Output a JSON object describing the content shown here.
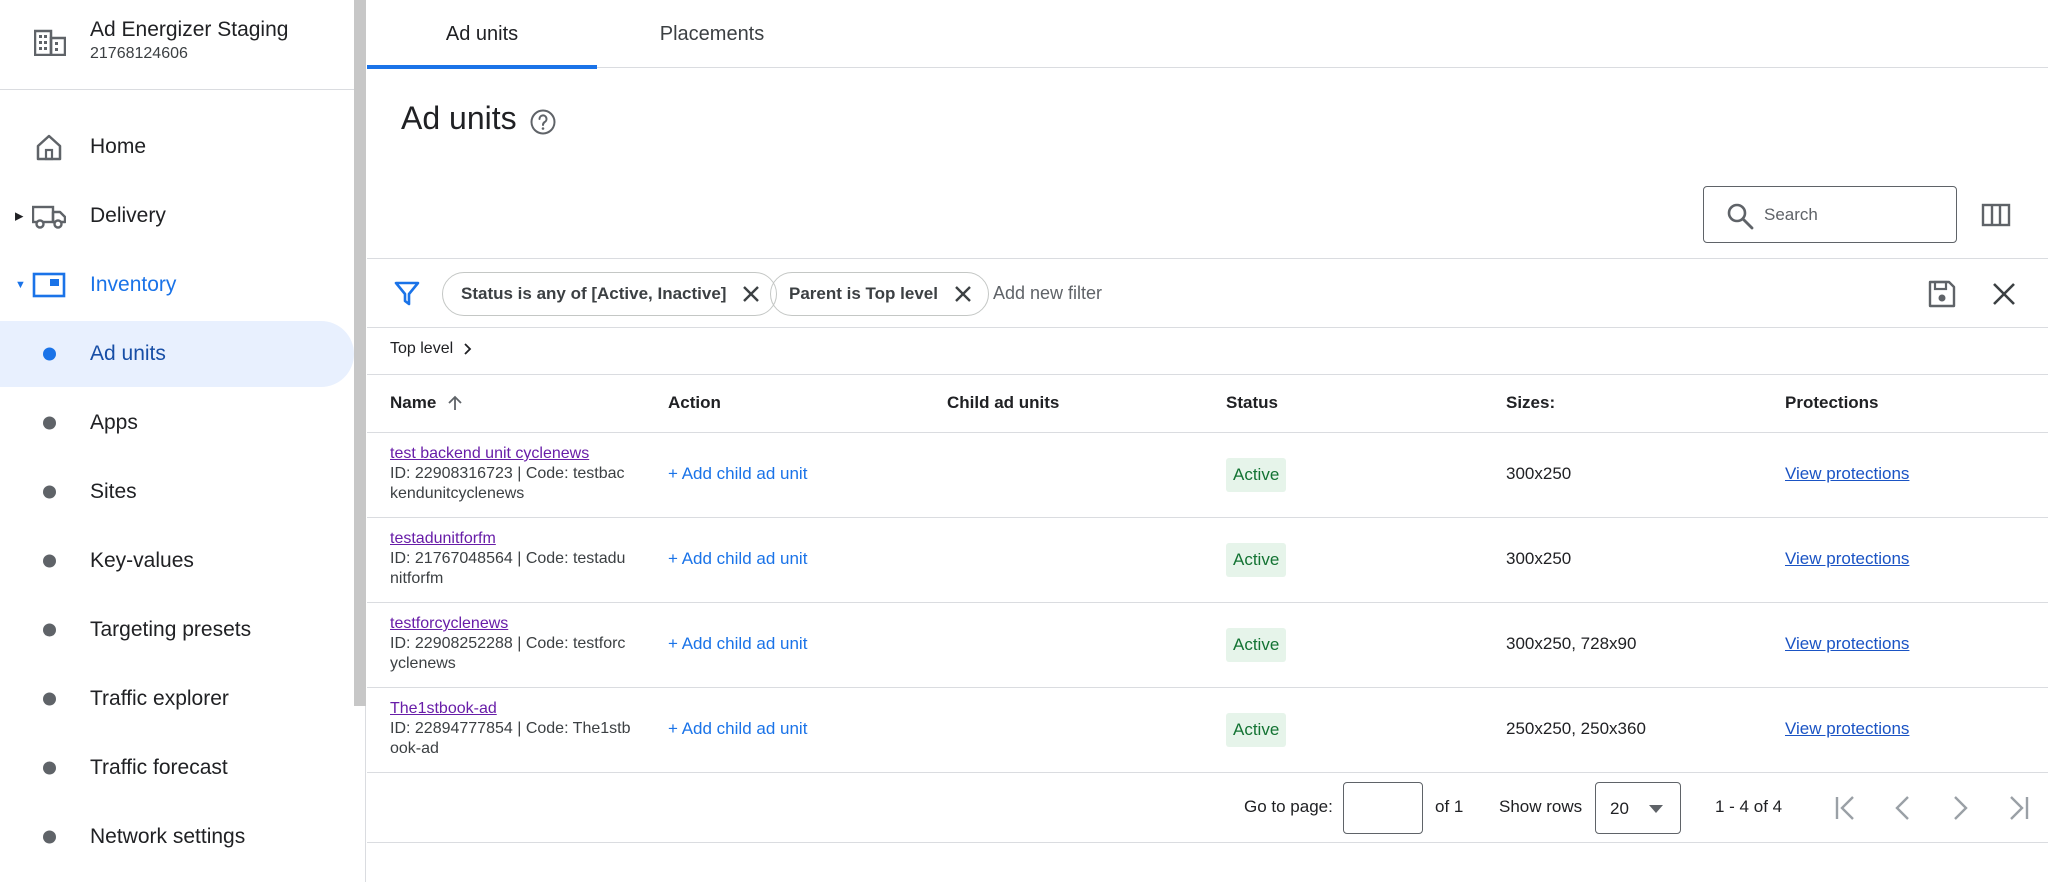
{
  "account": {
    "name": "Ad Energizer Staging",
    "id": "21768124606",
    "icon": "building-icon"
  },
  "sidebar": {
    "items": [
      {
        "label": "Home",
        "icon": "home-icon"
      },
      {
        "label": "Delivery",
        "icon": "truck-icon"
      },
      {
        "label": "Inventory",
        "icon": "inventory-icon"
      },
      {
        "label": "Ad units"
      },
      {
        "label": "Apps"
      },
      {
        "label": "Sites"
      },
      {
        "label": "Key-values"
      },
      {
        "label": "Targeting presets"
      },
      {
        "label": "Traffic explorer"
      },
      {
        "label": "Traffic forecast"
      },
      {
        "label": "Network settings"
      }
    ]
  },
  "tabs": [
    {
      "label": "Ad units"
    },
    {
      "label": "Placements"
    }
  ],
  "page": {
    "title": "Ad units"
  },
  "search": {
    "placeholder": "Search"
  },
  "filters": {
    "chips": [
      {
        "label": "Status is any of [Active, Inactive]"
      },
      {
        "label": "Parent is Top level"
      }
    ],
    "add_placeholder": "Add new filter"
  },
  "breadcrumb": {
    "label": "Top level"
  },
  "table": {
    "columns": [
      {
        "label": "Name"
      },
      {
        "label": "Action"
      },
      {
        "label": "Child ad units"
      },
      {
        "label": "Status"
      },
      {
        "label": "Sizes:"
      },
      {
        "label": "Protections"
      }
    ],
    "rows": [
      {
        "name": "test backend unit cyclenews",
        "meta": "ID: 22908316723 | Code: testbac kendunitcyclenews",
        "action": "+ Add child ad unit",
        "child": "",
        "status": "Active",
        "sizes": "300x250",
        "protections": "View protections"
      },
      {
        "name": "testadunitforfm",
        "meta": "ID: 21767048564 | Code: testadu nitforfm",
        "action": "+ Add child ad unit",
        "child": "",
        "status": "Active",
        "sizes": "300x250",
        "protections": "View protections"
      },
      {
        "name": "testforcyclenews",
        "meta": "ID: 22908252288 | Code: testforc yclenews",
        "action": "+ Add child ad unit",
        "child": "",
        "status": "Active",
        "sizes": "300x250, 728x90",
        "protections": "View protections"
      },
      {
        "name": "The1stbook-ad",
        "meta": "ID: 22894777854 | Code: The1stb ook-ad",
        "action": "+ Add child ad unit",
        "child": "",
        "status": "Active",
        "sizes": "250x250, 250x360",
        "protections": "View protections"
      }
    ]
  },
  "pagination": {
    "goto_label": "Go to page:",
    "page_value": "",
    "of_label": "of 1",
    "show_rows_label": "Show rows",
    "rows_value": "20",
    "range": "1 - 4 of 4"
  },
  "colors": {
    "accent": "#1a73e8",
    "selected_bg": "#e8f0fe",
    "active_badge_bg": "#e6f4ea",
    "active_badge_text": "#137333",
    "visited_link": "#681da8"
  }
}
